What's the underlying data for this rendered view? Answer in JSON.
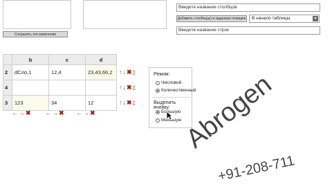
{
  "top": {
    "column_name_placeholder": "Введите название столбцов",
    "add_column_button": "Добавить столбец(ы) в заданную позицию",
    "position_select": "В начало таблицы",
    "row_name_placeholder": "Введите название строк",
    "add_row_button": "Сохранить эти изменения"
  },
  "table": {
    "columns": [
      "b",
      "c",
      "d"
    ],
    "rows": [
      {
        "num": "2",
        "cells": [
          "dСло,1",
          "12,4",
          "23,43,66,2"
        ]
      },
      {
        "num": "4",
        "cells": [
          "",
          "",
          ""
        ]
      },
      {
        "num": "3",
        "cells": [
          "123",
          "34",
          "12"
        ]
      }
    ]
  },
  "mode_panel": {
    "title": "Режим:",
    "options": [
      "Числовой",
      "Количественный"
    ],
    "selected": "Количественный",
    "highlight_title": "Выделить ячейку:",
    "highlight_options": [
      "Большую",
      "Меньшую"
    ],
    "highlight_selected": "Большую"
  },
  "watermark": {
    "name": "Abrogen",
    "phone": "+91-208-711"
  }
}
